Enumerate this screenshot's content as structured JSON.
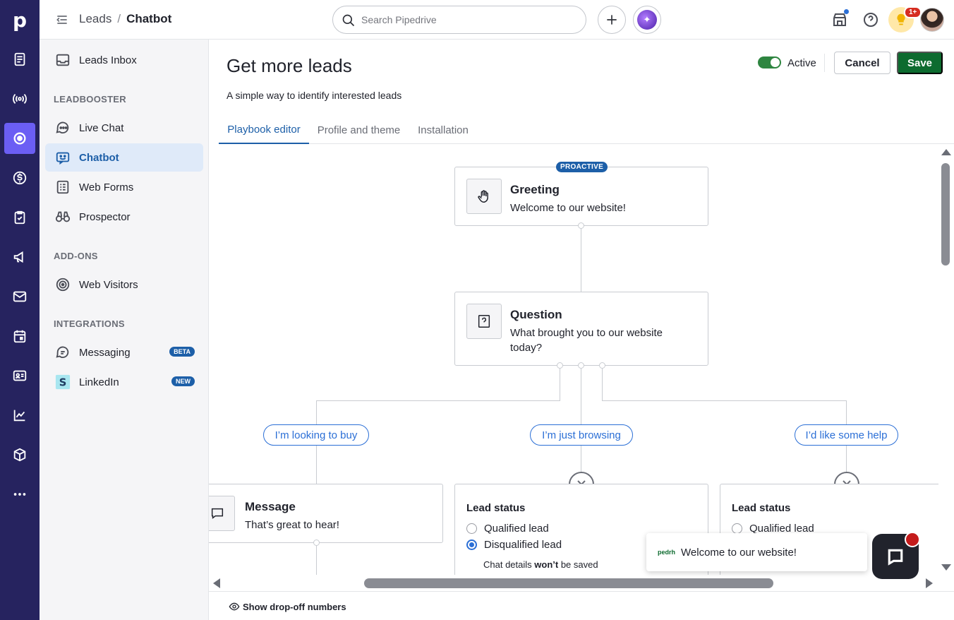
{
  "app": {
    "brand_letter": "p"
  },
  "header": {
    "breadcrumb_root": "Leads",
    "breadcrumb_sep": "/",
    "breadcrumb_current": "Chatbot",
    "search_placeholder": "Search Pipedrive",
    "notification_badge": "1+"
  },
  "rail": {
    "items": [
      "leads-icon",
      "activity-signal-icon",
      "leadbooster-target-icon",
      "deals-dollar-icon",
      "tasks-clipboard-icon",
      "campaigns-megaphone-icon",
      "mail-icon",
      "calendar-icon",
      "contacts-card-icon",
      "insights-chart-icon",
      "products-box-icon",
      "more-dots-icon"
    ],
    "active_index": 2
  },
  "sidebar": {
    "inbox_label": "Leads Inbox",
    "section_leadbooster": "LEADBOOSTER",
    "live_chat": "Live Chat",
    "chatbot": "Chatbot",
    "web_forms": "Web Forms",
    "prospector": "Prospector",
    "section_addons": "ADD-ONS",
    "web_visitors": "Web Visitors",
    "section_integrations": "INTEGRATIONS",
    "messaging": "Messaging",
    "messaging_badge": "BETA",
    "linkedin": "LinkedIn",
    "linkedin_badge": "NEW"
  },
  "main": {
    "title": "Get more leads",
    "subtitle": "A simple way to identify interested leads",
    "active_label": "Active",
    "active_state": true,
    "cancel_label": "Cancel",
    "save_label": "Save",
    "tabs": [
      {
        "label": "Playbook editor",
        "active": true
      },
      {
        "label": "Profile and theme",
        "active": false
      },
      {
        "label": "Installation",
        "active": false
      }
    ]
  },
  "flow": {
    "greeting": {
      "badge": "PROACTIVE",
      "title": "Greeting",
      "text": "Welcome to our website!"
    },
    "question": {
      "title": "Question",
      "text_line1": "What brought you to our website",
      "text_line2": "today?"
    },
    "answers": [
      "I’m looking to buy",
      "I’m just browsing",
      "I’d like some help"
    ],
    "message": {
      "title": "Message",
      "text": "That’s great to hear!"
    },
    "lead_status_1": {
      "label": "Lead status",
      "options": [
        "Qualified lead",
        "Disqualified lead"
      ],
      "selected": "Disqualified lead",
      "note_prefix": "Chat details ",
      "note_bold": "won’t",
      "note_suffix": " be saved"
    },
    "lead_status_2": {
      "label": "Lead status",
      "options": [
        "Qualified lead"
      ]
    }
  },
  "footer": {
    "dropoff_label": "Show drop-off numbers"
  },
  "chat_widget": {
    "brand": "pedrh",
    "popup_text": "Welcome to our website!"
  },
  "colors": {
    "rail_bg": "#26235f",
    "rail_active": "#6b5ef4",
    "accent_blue": "#1d5fa8",
    "save_green": "#0d6b2f",
    "toggle_green": "#2e8540"
  }
}
